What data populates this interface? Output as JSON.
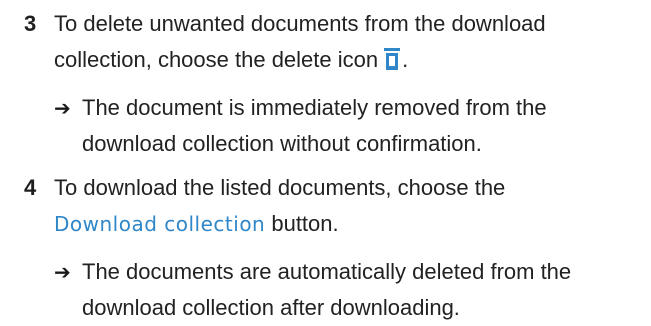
{
  "steps": [
    {
      "number": "3",
      "instruction_line1": "To delete unwanted documents from the download",
      "instruction_line2": "collection, choose the delete icon",
      "instruction_end": ".",
      "icon": "trash-icon",
      "result_line1": "The document is immediately removed from the",
      "result_line2": "download collection without confirmation."
    },
    {
      "number": "4",
      "instruction_line1": "To download the listed documents, choose the",
      "button_label": "Download collection",
      "instruction_end": " button.",
      "result_line1": "The documents are automatically deleted from the",
      "result_line2": "download collection after downloading."
    }
  ],
  "colors": {
    "link": "#2f87c9",
    "icon": "#2f87c9"
  }
}
